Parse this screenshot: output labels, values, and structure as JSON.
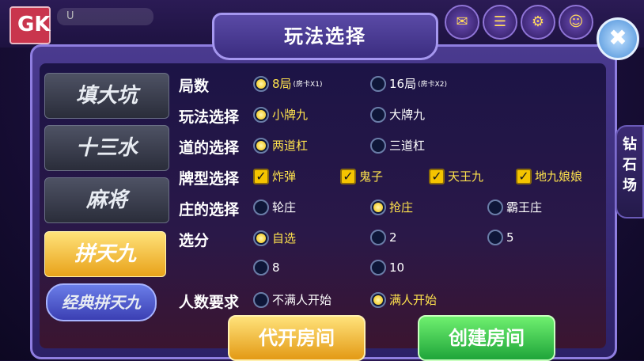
{
  "header": {
    "username": "U",
    "icons": [
      "mail-icon",
      "list-icon",
      "settings-icon",
      "service-icon"
    ]
  },
  "dialog": {
    "title": "玩法选择",
    "close_label": "✖"
  },
  "sidebar": {
    "items": [
      {
        "label": "填大坑"
      },
      {
        "label": "十三水"
      },
      {
        "label": "麻将"
      },
      {
        "label": "拼天九"
      }
    ],
    "sub_items": [
      {
        "label": "经典拼天九"
      }
    ]
  },
  "rows": {
    "rounds": {
      "label": "局数",
      "options": [
        {
          "text": "8局",
          "tag": "(房卡X1)"
        },
        {
          "text": "16局",
          "tag": "(房卡X2)"
        }
      ]
    },
    "mode": {
      "label": "玩法选择",
      "options": [
        {
          "text": "小牌九"
        },
        {
          "text": "大牌九"
        }
      ]
    },
    "bars": {
      "label": "道的选择",
      "options": [
        {
          "text": "两道杠"
        },
        {
          "text": "三道杠"
        }
      ]
    },
    "cards": {
      "label": "牌型选择",
      "options": [
        {
          "text": "炸弹"
        },
        {
          "text": "鬼子"
        },
        {
          "text": "天王九"
        },
        {
          "text": "地九娘娘"
        }
      ]
    },
    "banker": {
      "label": "庄的选择",
      "options": [
        {
          "text": "轮庄"
        },
        {
          "text": "抢庄"
        },
        {
          "text": "霸王庄"
        }
      ]
    },
    "score": {
      "label": "选分",
      "options": [
        {
          "text": "自选"
        },
        {
          "text": "2"
        },
        {
          "text": "5"
        },
        {
          "text": "8"
        },
        {
          "text": "10"
        }
      ]
    },
    "players": {
      "label": "人数要求",
      "options": [
        {
          "text": "不满人开始"
        },
        {
          "text": "满人开始"
        }
      ]
    }
  },
  "buttons": {
    "proxy": "代开房间",
    "create": "创建房间"
  },
  "shop": {
    "label": "钻石场"
  },
  "colors": {
    "selected": "#ffe34d",
    "accent": "#f5c400"
  }
}
